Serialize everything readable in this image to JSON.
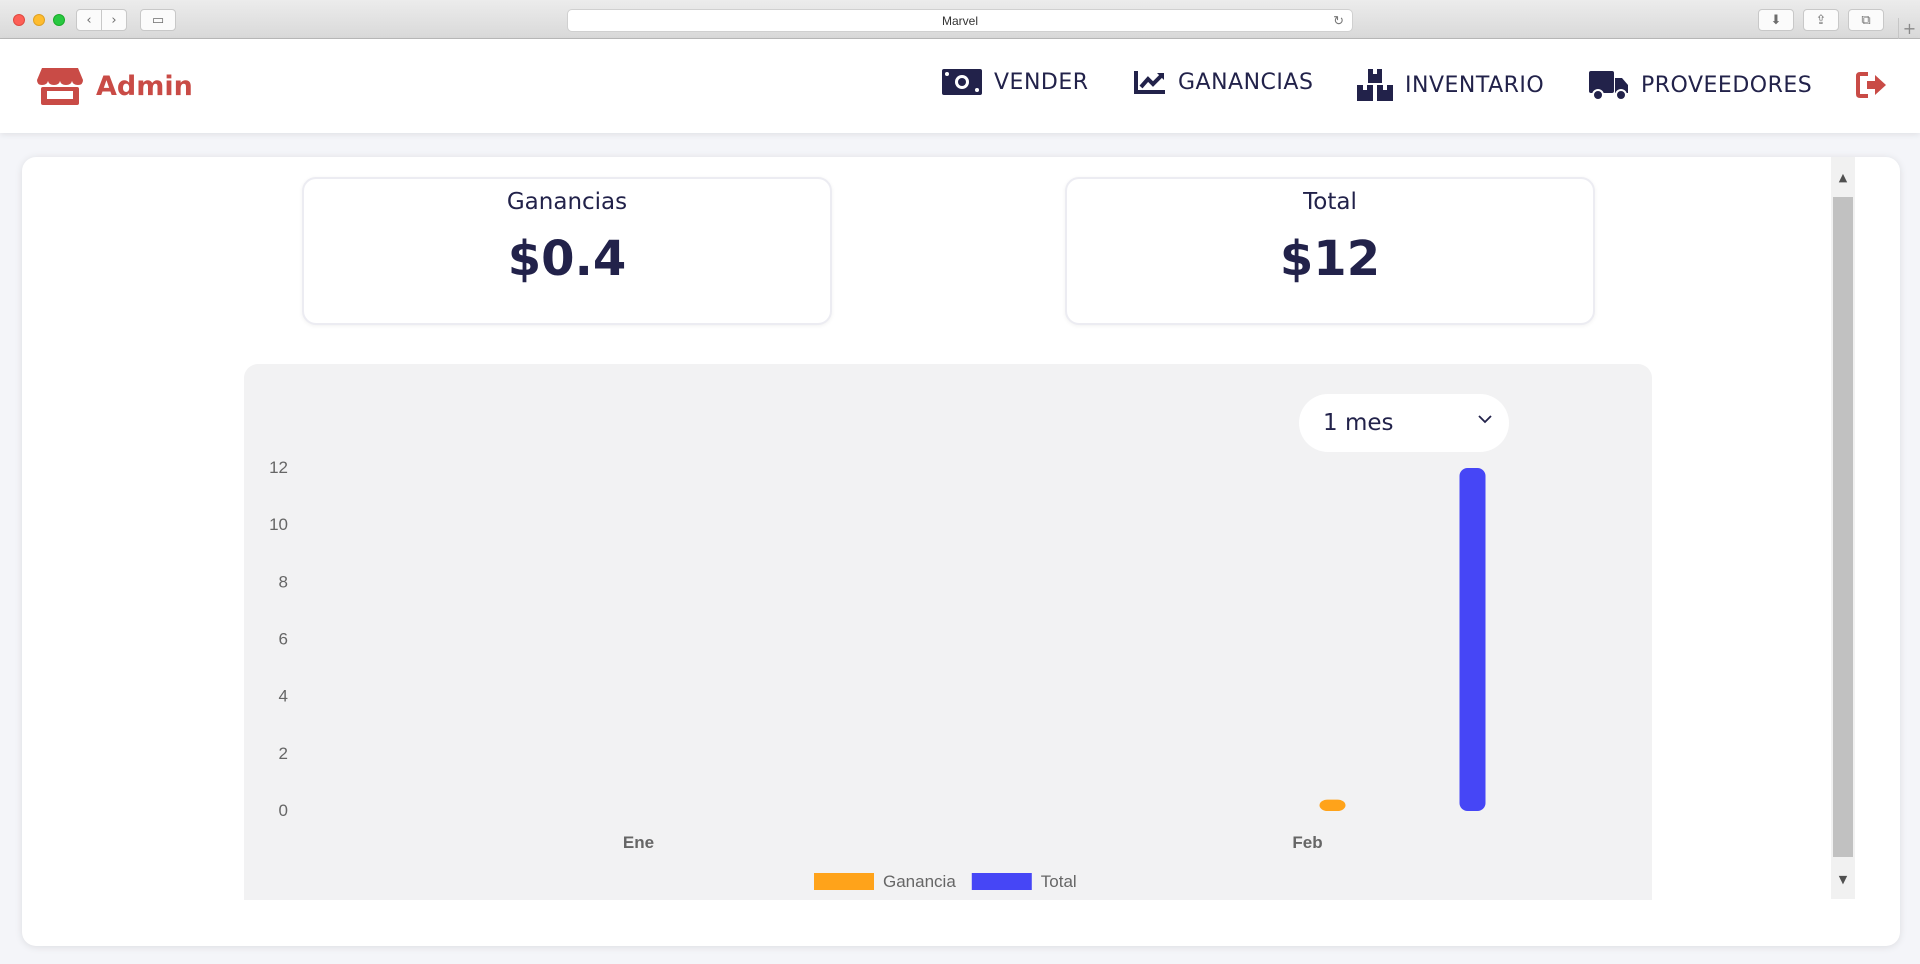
{
  "browser": {
    "title": "Marvel",
    "back_glyph": "‹",
    "forward_glyph": "›",
    "sidebar_glyph": "▭",
    "reload_glyph": "↻",
    "download_glyph": "⬇",
    "share_glyph": "⇪",
    "tabs_glyph": "⧉",
    "new_tab_glyph": "+"
  },
  "header": {
    "brand": "Admin",
    "brand_color": "#c94b46",
    "nav_color": "#22224a",
    "nav": [
      {
        "label": "VENDER",
        "icon": "money-bill-icon"
      },
      {
        "label": "GANANCIAS",
        "icon": "chart-line-icon"
      },
      {
        "label": "INVENTARIO",
        "icon": "boxes-icon"
      },
      {
        "label": "PROVEEDORES",
        "icon": "truck-icon"
      }
    ],
    "logout_icon": "logout-icon"
  },
  "stats": {
    "ganancias_title": "Ganancias",
    "ganancias_value": "$0.4",
    "total_title": "Total",
    "total_value": "$12"
  },
  "period_select": {
    "value": "1 mes"
  },
  "chart_data": {
    "type": "bar",
    "categories": [
      "Ene",
      "Feb"
    ],
    "series": [
      {
        "name": "Ganancia",
        "values": [
          0,
          0.4
        ],
        "color": "#ffa31a"
      },
      {
        "name": "Total",
        "values": [
          0,
          12
        ],
        "color": "#4646f6"
      }
    ],
    "ylim": [
      0,
      12
    ],
    "yticks": [
      0,
      2,
      4,
      6,
      8,
      10,
      12
    ],
    "legend": "bottom",
    "grid": false
  },
  "scrollbar": {
    "up_glyph": "▲",
    "down_glyph": "▼"
  }
}
